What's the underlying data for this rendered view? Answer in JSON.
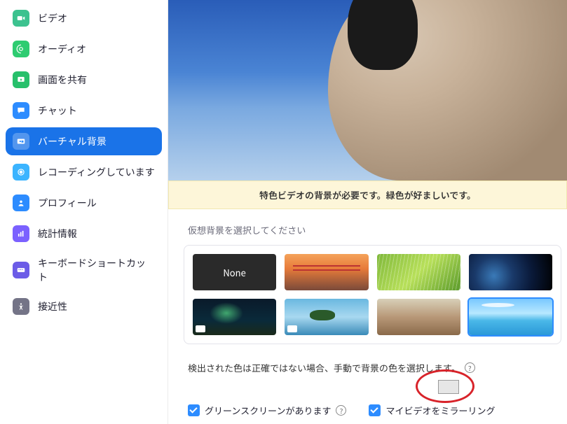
{
  "sidebar": {
    "items": [
      {
        "label": "ビデオ",
        "icon": "video-icon"
      },
      {
        "label": "オーディオ",
        "icon": "audio-icon"
      },
      {
        "label": "画面を共有",
        "icon": "share-screen-icon"
      },
      {
        "label": "チャット",
        "icon": "chat-icon"
      },
      {
        "label": "バーチャル背景",
        "icon": "virtual-bg-icon",
        "active": true
      },
      {
        "label": "レコーディングしています",
        "icon": "recording-icon"
      },
      {
        "label": "プロフィール",
        "icon": "profile-icon"
      },
      {
        "label": "統計情報",
        "icon": "statistics-icon"
      },
      {
        "label": "キーボードショートカット",
        "icon": "keyboard-icon"
      },
      {
        "label": "接近性",
        "icon": "accessibility-icon"
      }
    ]
  },
  "preview": {
    "warning": "特色ビデオの背景が必要です。緑色が好ましいです。"
  },
  "backgrounds": {
    "section_label": "仮想背景を選択してください",
    "none_label": "None",
    "items": [
      {
        "name": "none",
        "label": "None"
      },
      {
        "name": "bridge",
        "label": "Golden Gate"
      },
      {
        "name": "grass",
        "label": "Grass"
      },
      {
        "name": "earth",
        "label": "Earth"
      },
      {
        "name": "aurora",
        "label": "Aurora",
        "is_video": true
      },
      {
        "name": "island",
        "label": "Island",
        "is_video": true
      },
      {
        "name": "beach",
        "label": "Beach"
      },
      {
        "name": "ocean",
        "label": "Ocean",
        "selected": true
      }
    ]
  },
  "manual_color": {
    "hint": "検出された色は正確ではない場合、手動で背景の色を選択します。",
    "swatch_color": "#e6e6e6"
  },
  "options": {
    "green_screen_label": "グリーンスクリーンがあります",
    "green_screen_checked": true,
    "mirror_label": "マイビデオをミラーリング",
    "mirror_checked": true
  }
}
